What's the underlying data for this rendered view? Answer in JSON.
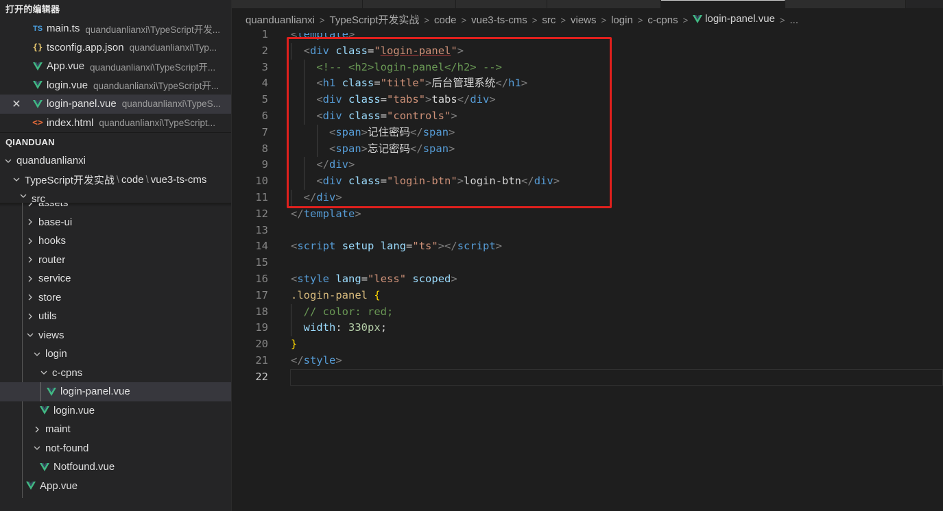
{
  "sidebar": {
    "open_editors_title": "打开的编辑器",
    "open_editors": [
      {
        "icon": "ts",
        "icon_text": "TS",
        "name": "main.ts",
        "path": "quanduanlianxi\\TypeScript开发..."
      },
      {
        "icon": "json",
        "icon_text": "{}",
        "name": "tsconfig.app.json",
        "path": "quanduanlianxi\\Typ..."
      },
      {
        "icon": "vue",
        "name": "App.vue",
        "path": "quanduanlianxi\\TypeScript开..."
      },
      {
        "icon": "vue",
        "name": "login.vue",
        "path": "quanduanlianxi\\TypeScript开..."
      },
      {
        "icon": "vue",
        "name": "login-panel.vue",
        "path": "quanduanlianxi\\TypeS...",
        "active": true
      },
      {
        "icon": "html",
        "icon_text": "<>",
        "name": "index.html",
        "path": "quanduanlianxi\\TypeScript..."
      }
    ],
    "workspace_title": "QIANDUAN",
    "tree": {
      "root": "quanduanlianxi",
      "compact_path": [
        "TypeScript开发实战",
        "code",
        "vue3-ts-cms"
      ],
      "src": "src",
      "folders": [
        "assets",
        "base-ui",
        "hooks",
        "router",
        "service",
        "store",
        "utils"
      ],
      "views": "views",
      "login": "login",
      "c_cpns": "c-cpns",
      "login_panel": "login-panel.vue",
      "login_vue": "login.vue",
      "maint": "maint",
      "not_found": "not-found",
      "notfound_vue": "Notfound.vue",
      "app_vue": "App.vue"
    }
  },
  "editor": {
    "breadcrumb": [
      "quanduanlianxi",
      "TypeScript开发实战",
      "code",
      "vue3-ts-cms",
      "src",
      "views",
      "login",
      "c-cpns",
      "login-panel.vue",
      "..."
    ],
    "current_line": 22,
    "line_numbers": [
      "1",
      "2",
      "3",
      "4",
      "5",
      "6",
      "7",
      "8",
      "9",
      "10",
      "11",
      "12",
      "13",
      "14",
      "15",
      "16",
      "17",
      "18",
      "19",
      "20",
      "21",
      "22"
    ]
  },
  "colors": {
    "vue_green": "#41b883",
    "highlight_box": "#e0201d",
    "tag": "#569cd6",
    "attr": "#9cdcfe",
    "string": "#ce9178",
    "comment": "#6a9955"
  }
}
